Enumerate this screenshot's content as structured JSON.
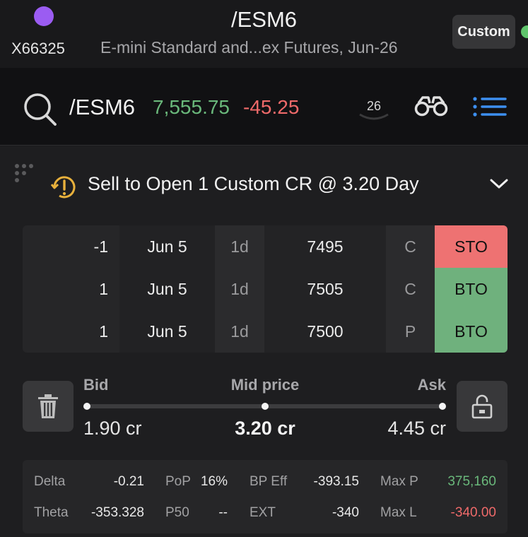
{
  "colors": {
    "accent_purple": "#9b5cf2",
    "edge_green": "#5fc46c",
    "positive": "#6ab87b",
    "negative": "#ef6a6a",
    "sell": "#ee7272",
    "buy": "#6fb17d",
    "warning": "#e8b13c",
    "list_blue": "#3d8ff0"
  },
  "header": {
    "account": "X66325",
    "symbol": "/ESM6",
    "description": "E-mini Standard and...ex Futures, Jun-26",
    "custom_button": "Custom"
  },
  "quote": {
    "search_icon": "search-icon",
    "symbol": "/ESM6",
    "price": "7,555.75",
    "change": "-45.25",
    "calendar_day": "26",
    "binoculars_icon": "binoculars-icon",
    "list_icon": "list-icon"
  },
  "order": {
    "summary": "Sell to Open 1 Custom CR @ 3.20 Day",
    "legs": [
      {
        "qty": "-1",
        "exp": "Jun 5",
        "dte": "1d",
        "strike": "7495",
        "type": "C",
        "action": "STO"
      },
      {
        "qty": "1",
        "exp": "Jun 5",
        "dte": "1d",
        "strike": "7505",
        "type": "C",
        "action": "BTO"
      },
      {
        "qty": "1",
        "exp": "Jun 5",
        "dte": "1d",
        "strike": "7500",
        "type": "P",
        "action": "BTO"
      }
    ],
    "price": {
      "bid_label": "Bid",
      "mid_label": "Mid price",
      "ask_label": "Ask",
      "bid": "1.90 cr",
      "mid": "3.20 cr",
      "ask": "4.45 cr"
    },
    "stats": {
      "delta_label": "Delta",
      "delta": "-0.21",
      "pop_label": "PoP",
      "pop": "16%",
      "bp_label": "BP Eff",
      "bp": "-393.15",
      "maxp_label": "Max P",
      "maxp": "375,160",
      "theta_label": "Theta",
      "theta": "-353.328",
      "p50_label": "P50",
      "p50": "--",
      "ext_label": "EXT",
      "ext": "-340",
      "maxl_label": "Max L",
      "maxl": "-340.00"
    }
  }
}
